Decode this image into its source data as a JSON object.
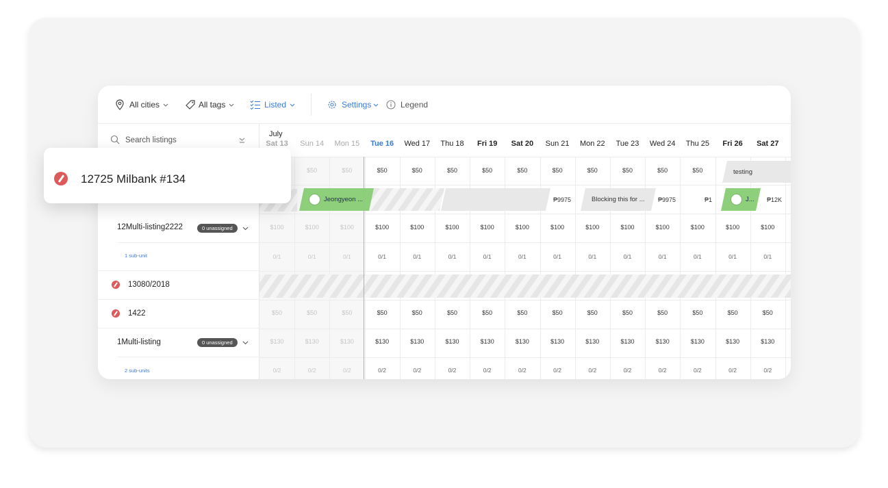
{
  "toolbar": {
    "cities": "All cities",
    "tags": "All tags",
    "listed": "Listed",
    "settings": "Settings",
    "legend": "Legend"
  },
  "sidebar": {
    "search_placeholder": "Search listings",
    "listings": [
      {
        "name": "12Multi-listing2222",
        "badge": "0 unassigned",
        "subunits": "1 sub-unit"
      },
      {
        "name": "13080/2018"
      },
      {
        "name": "1422"
      },
      {
        "name": "1Multi-listing",
        "badge": "0 unassigned",
        "subunits": "2 sub-units"
      }
    ]
  },
  "popup": {
    "title": "12725 Milbank #134"
  },
  "calendar": {
    "month": "July",
    "days": [
      "Sat 13",
      "Sun 14",
      "Mon 15",
      "Tue 16",
      "Wed 17",
      "Thu 18",
      "Fri 19",
      "Sat 20",
      "Sun 21",
      "Mon 22",
      "Tue 23",
      "Wed 24",
      "Thu 25",
      "Fri 26",
      "Sat 27"
    ],
    "row1_prices": [
      "",
      "$50",
      "$50",
      "$50",
      "$50",
      "$50",
      "$50",
      "$50",
      "$50",
      "$50",
      "$50",
      "$50",
      "$50",
      "",
      ""
    ],
    "row1_block": "testing",
    "row2": {
      "reservation_1": "Jeongyeon ...",
      "price_sun21": "₱9975",
      "block_text": "Blocking this for ...",
      "price_wed24": "₱9975",
      "price_thu25": "₱1",
      "reservation_2": "J...",
      "price_sat27": "₱12K"
    },
    "row3_prices": [
      "$100",
      "$100",
      "$100",
      "$100",
      "$100",
      "$100",
      "$100",
      "$100",
      "$100",
      "$100",
      "$100",
      "$100",
      "$100",
      "$100",
      "$100"
    ],
    "row4_occ": [
      "0/1",
      "0/1",
      "0/1",
      "0/1",
      "0/1",
      "0/1",
      "0/1",
      "0/1",
      "0/1",
      "0/1",
      "0/1",
      "0/1",
      "0/1",
      "0/1",
      "0/1"
    ],
    "row6_prices": [
      "$50",
      "$50",
      "$50",
      "$50",
      "$50",
      "$50",
      "$50",
      "$50",
      "$50",
      "$50",
      "$50",
      "$50",
      "$50",
      "$50",
      "$50"
    ],
    "row7_prices": [
      "$130",
      "$130",
      "$130",
      "$130",
      "$130",
      "$130",
      "$130",
      "$130",
      "$130",
      "$130",
      "$130",
      "$130",
      "$130",
      "$130",
      "$130"
    ],
    "row8_occ": [
      "0/2",
      "0/2",
      "0/2",
      "0/2",
      "0/2",
      "0/2",
      "0/2",
      "0/2",
      "0/2",
      "0/2",
      "0/2",
      "0/2",
      "0/2",
      "0/2",
      "0/2"
    ]
  },
  "colors": {
    "accent": "#3a7bd5",
    "reservation": "#8ecf7c",
    "cleaning": "#dd5a5a"
  }
}
